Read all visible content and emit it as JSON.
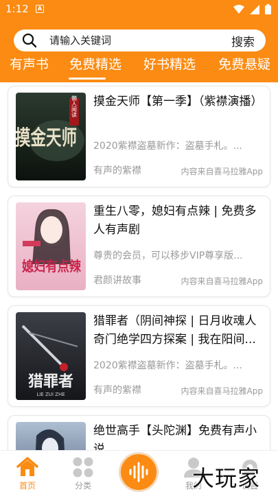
{
  "status_bar": {
    "time": "1:12",
    "app_badge": "A"
  },
  "search": {
    "placeholder": "请输入关键词",
    "button_label": "搜索"
  },
  "tabs": [
    {
      "label": "有声书"
    },
    {
      "label": "免费精选",
      "active": true
    },
    {
      "label": "好书精选"
    },
    {
      "label": "免费悬疑"
    }
  ],
  "books": [
    {
      "title": "摸金天师【第一季】（紫襟演播）",
      "desc": "2020紫襟盗墓新作：盗墓手札。...",
      "author": "有声的紫襟",
      "source": "内容来自喜马拉雅App",
      "cover": {
        "big_text": "摸金天师",
        "seal": "懒人阅读"
      }
    },
    {
      "title": "重生八零，媳妇有点辣 | 免费多人有声剧",
      "desc": "尊贵的会员，可以移步VIP尊享版...",
      "author": "君颜讲故事",
      "source": "内容来自喜马拉雅App",
      "cover": {
        "big_text": "媳妇有点辣"
      }
    },
    {
      "title": "猎罪者（阴间神探 | 日月收魂人 奇门绝学四方探案 | 我在阳间...",
      "desc": "2020紫襟盗墓新作：盗墓手札。...",
      "author": "有声的紫襟",
      "source": "内容来自喜马拉雅App",
      "cover": {
        "big_text": "猎罪者",
        "sub": "LIE ZUI ZHE"
      }
    },
    {
      "title": "绝世高手【头陀渊】免费有声小说",
      "desc": "",
      "author": "",
      "source": "",
      "cover": {}
    }
  ],
  "bottom_nav": {
    "home": "首页",
    "category": "分类",
    "mine": "我的",
    "settings": "设置"
  },
  "watermark": "大玩家",
  "colors": {
    "accent": "#fb8b12",
    "text_muted": "#9a9a9a"
  }
}
